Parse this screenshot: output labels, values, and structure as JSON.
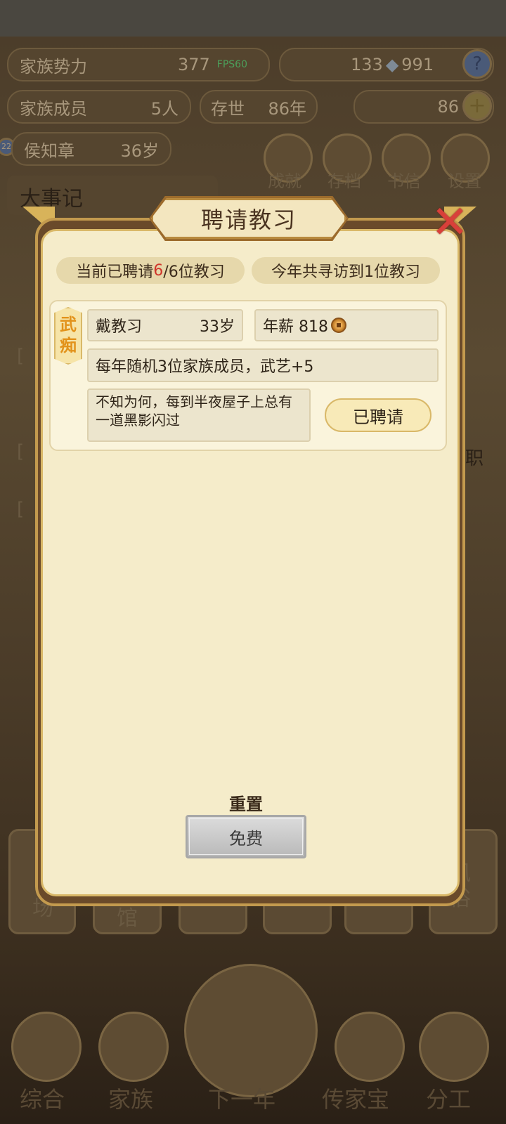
{
  "hud": {
    "family_power_label": "家族势力",
    "family_power_value": "377",
    "fps_label": "FPS60",
    "resource_count": "133",
    "coin_count": "991",
    "help_icon": "?",
    "members_label": "家族成员",
    "members_value": "5人",
    "alive_label": "存世",
    "alive_value": "86年",
    "gold_value": "86",
    "plus_icon": "+",
    "head_badge": "22",
    "head_name": "侯知章",
    "head_age": "36岁"
  },
  "menu": {
    "achievements": "成就",
    "save": "存档",
    "letters": "书信",
    "settings": "设置"
  },
  "events_title": "大事记",
  "bg_partial": {
    "l1": "[",
    "l2": "[",
    "l3": "[",
    "r1": "职",
    "s1": "场",
    "s2": "馆",
    "s3": "凤",
    "s4": "俗"
  },
  "bottom_nav": {
    "overview": "综合",
    "family": "家族",
    "next_year": "下一年",
    "heirloom": "传家宝",
    "division": "分工"
  },
  "dialog": {
    "title": "聘请教习",
    "hired_prefix": "当前已聘请",
    "hired_count": "6",
    "hired_suffix": "/6位教习",
    "visited": "今年共寻访到1位教习",
    "tutor": {
      "tag": "武痴",
      "name": "戴教习",
      "age": "33岁",
      "salary_label": "年薪 818",
      "effect": "每年随机3位家族成员，武艺+5",
      "description": "不知为何，每到半夜屋子上总有一道黑影闪过",
      "status_button": "已聘请"
    },
    "reset_label": "重置",
    "free_button": "免费"
  }
}
